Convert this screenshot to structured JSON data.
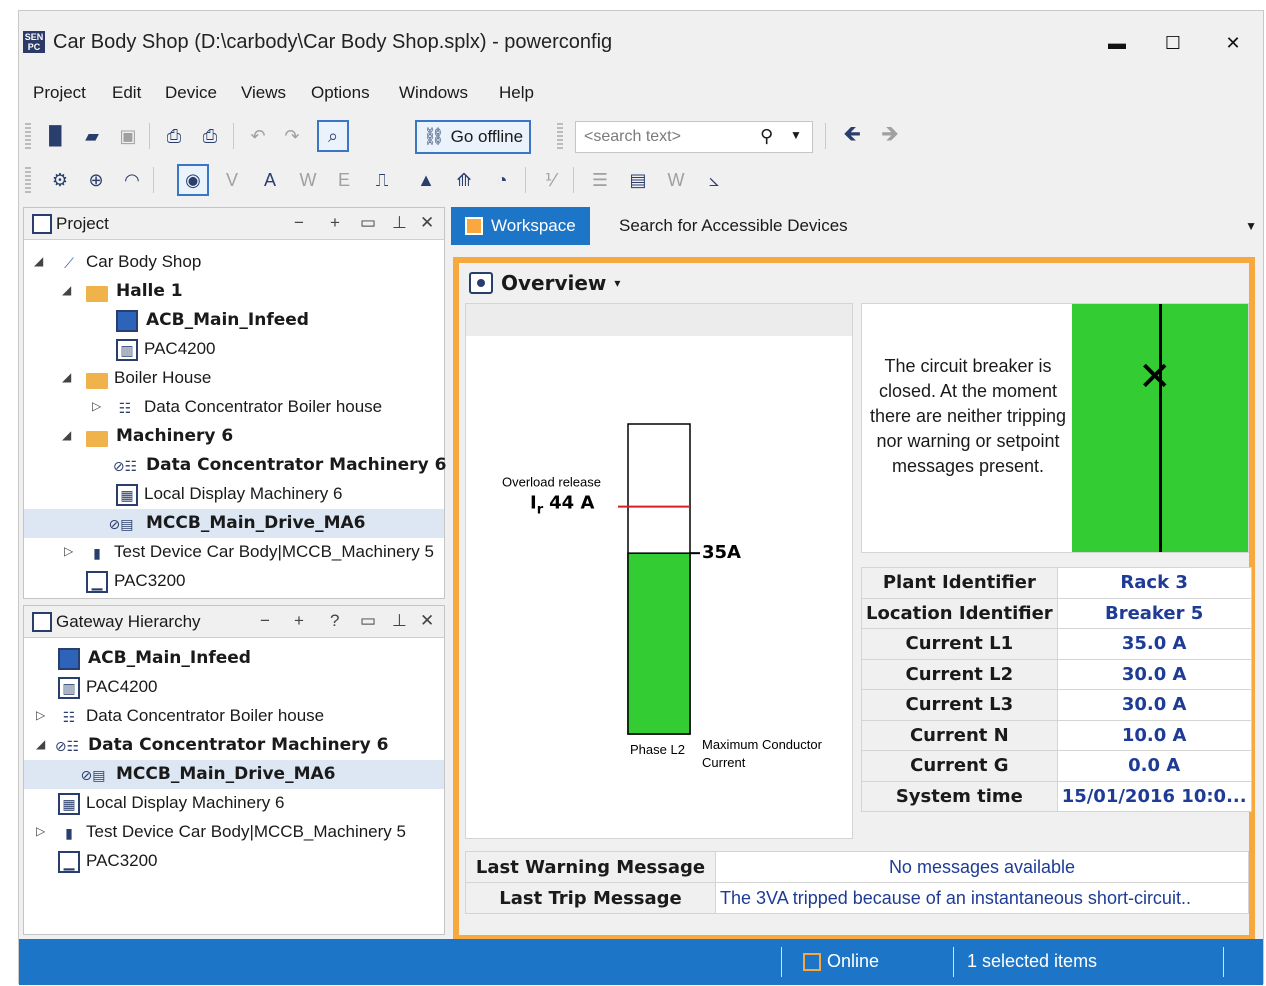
{
  "window": {
    "title": "Car Body Shop (D:\\carbody\\Car Body Shop.splx) - powerconfig",
    "app_icon_text": "SEN PC",
    "controls": {
      "minimize": "▬",
      "maximize": "☐",
      "close": "✕"
    }
  },
  "menu": [
    "Project",
    "Edit",
    "Device",
    "Views",
    "Options",
    "Windows",
    "Help"
  ],
  "toolbar": {
    "go_offline_label": "Go offline",
    "search_placeholder": "<search text>"
  },
  "project_panel": {
    "title": "Project",
    "tree": [
      {
        "label": "Car Body Shop",
        "bold": false,
        "icon": "plant-icon"
      },
      {
        "label": "Halle 1",
        "bold": true,
        "icon": "folder-icon"
      },
      {
        "label": "ACB_Main_Infeed",
        "bold": true,
        "icon": "breaker-icon"
      },
      {
        "label": "PAC4200",
        "bold": false,
        "icon": "meter-icon"
      },
      {
        "label": "Boiler House",
        "bold": false,
        "icon": "folder-icon"
      },
      {
        "label": "Data Concentrator Boiler house",
        "bold": false,
        "icon": "concentrator-icon"
      },
      {
        "label": "Machinery 6",
        "bold": true,
        "icon": "folder-icon"
      },
      {
        "label": "Data Concentrator Machinery 6",
        "bold": true,
        "icon": "concentrator-online-icon"
      },
      {
        "label": "Local Display Machinery 6",
        "bold": false,
        "icon": "display-icon"
      },
      {
        "label": "MCCB_Main_Drive_MA6",
        "bold": true,
        "icon": "mccb-online-icon"
      },
      {
        "label": "Test Device Car Body|MCCB_Machinery 5",
        "bold": false,
        "icon": "test-device-icon"
      },
      {
        "label": "PAC3200",
        "bold": false,
        "icon": "meter-icon"
      }
    ]
  },
  "gateway_panel": {
    "title": "Gateway Hierarchy",
    "help": "?",
    "tree": [
      {
        "label": "ACB_Main_Infeed",
        "bold": true
      },
      {
        "label": "PAC4200",
        "bold": false
      },
      {
        "label": "Data Concentrator Boiler house",
        "bold": false
      },
      {
        "label": "Data Concentrator Machinery 6",
        "bold": true
      },
      {
        "label": "MCCB_Main_Drive_MA6",
        "bold": true
      },
      {
        "label": "Local Display Machinery 6",
        "bold": false
      },
      {
        "label": "Test Device Car Body|MCCB_Machinery 5",
        "bold": false
      },
      {
        "label": "PAC3200",
        "bold": false
      }
    ]
  },
  "tabs": [
    "Workspace",
    "Search for Accessible Devices"
  ],
  "overview": {
    "title": "Overview",
    "chart": {
      "overload_label": "Overload release",
      "ir_label": "I",
      "ir_sub": "r",
      "ir_value": "44 A",
      "current_label": "35A",
      "phase_label": "Phase L2",
      "max_label_1": "Maximum Conductor",
      "max_label_2": "Current"
    },
    "chart_data": {
      "type": "bar",
      "categories": [
        "Phase L2"
      ],
      "values": [
        35
      ],
      "threshold": 44,
      "ylim": [
        0,
        60
      ]
    },
    "status_message": "The circuit breaker is closed. At the moment there are neither tripping nor warning or setpoint messages present.",
    "breaker_color": "#33cc33",
    "info": [
      {
        "key": "Plant Identifier",
        "value": "Rack 3"
      },
      {
        "key": "Location Identifier",
        "value": "Breaker 5"
      },
      {
        "key": "Current L1",
        "value": "35.0 A"
      },
      {
        "key": "Current L2",
        "value": "30.0 A"
      },
      {
        "key": "Current L3",
        "value": "30.0 A"
      },
      {
        "key": "Current N",
        "value": "10.0 A"
      },
      {
        "key": "Current G",
        "value": "0.0 A"
      },
      {
        "key": "System time",
        "value": "15/01/2016 10:0..."
      }
    ],
    "messages": [
      {
        "key": "Last Warning Message",
        "value": "No messages available"
      },
      {
        "key": "Last Trip Message",
        "value": "The 3VA tripped because of an instantaneous short-circuit.."
      }
    ]
  },
  "statusbar": {
    "online": "Online",
    "selected": "1 selected items"
  },
  "colors": {
    "accent": "#1c75c7",
    "workspace_border": "#f7a93f",
    "value_text": "#1e3c96"
  }
}
